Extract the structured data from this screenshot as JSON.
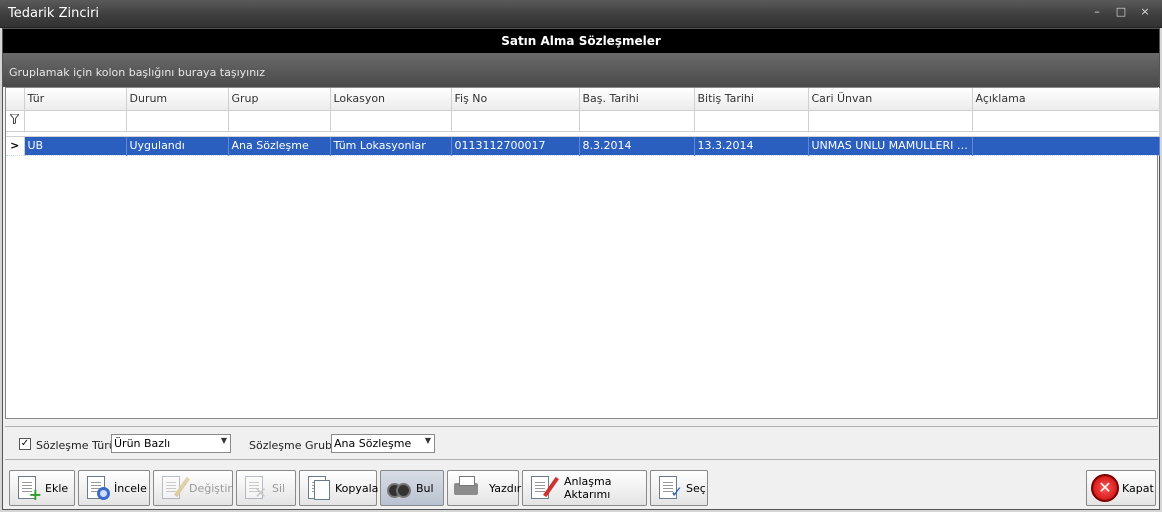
{
  "window": {
    "title": "Tedarik Zinciri",
    "controls": {
      "minimize": "–",
      "maximize": "□",
      "close": "×"
    }
  },
  "header": {
    "title": "Satın Alma Sözleşmeler"
  },
  "group_band": {
    "hint": "Gruplamak için kolon başlığını buraya taşıyınız"
  },
  "grid": {
    "filter_icon": "filter-icon",
    "columns": [
      "Tür",
      "Durum",
      "Grup",
      "Lokasyon",
      "Fiş No",
      "Baş. Tarihi",
      "Bitiş Tarihi",
      "Cari Ünvan",
      "Açıklama"
    ],
    "rows": [
      {
        "indicator": ">",
        "cells": [
          "UB",
          "Uygulandı",
          "Ana Sözleşme",
          "Tüm Lokasyonlar",
          "0113112700017",
          "8.3.2014",
          "13.3.2014",
          "UNMAS UNLU MAMULLERI SA...",
          ""
        ],
        "selected": true
      }
    ]
  },
  "filters": {
    "contract_type": {
      "checked": true,
      "check_glyph": "✓",
      "label": "Sözleşme Türü",
      "value": "Ürün Bazlı",
      "arrow": "▼"
    },
    "contract_group": {
      "label": "Sözleşme Grubu",
      "value": "Ana Sözleşme",
      "arrow": "▼"
    }
  },
  "toolbar": {
    "add": "Ekle",
    "inspect": "İncele",
    "edit": "Değiştir",
    "delete": "Sil",
    "copy": "Kopyala",
    "find": "Bul",
    "print": "Yazdır",
    "transfer": "Anlaşma Aktarımı",
    "select": "Seç",
    "close": "Kapat",
    "close_glyph": "✕",
    "check_glyph": "✓",
    "plus_glyph": "+",
    "x_glyph": "✕"
  },
  "colors": {
    "selection": "#2a5fbf",
    "header_bg": "#000000",
    "title_bar": "#3c3c3c"
  }
}
